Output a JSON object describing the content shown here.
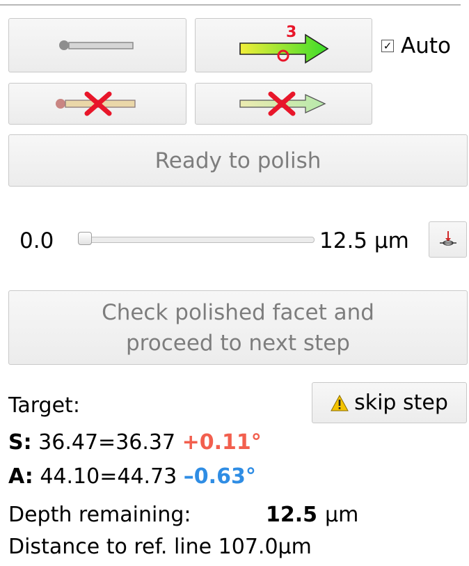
{
  "toolbar": {
    "auto_label": "Auto",
    "auto_checked": true,
    "arrow_badge": "3",
    "ready_label": "Ready to polish",
    "check_label_line1": "Check polished facet and",
    "check_label_line2": "proceed to next step",
    "skip_label": "skip step"
  },
  "slider": {
    "min_label": "0.0",
    "max_label": "12.5 µm",
    "value_fraction": 0.0
  },
  "target": {
    "label": "Target:",
    "s": {
      "letter": "S",
      "value": "36.47",
      "ref": "36.37",
      "sign": "+",
      "delta": "0.11°"
    },
    "a": {
      "letter": "A",
      "value": "44.10",
      "ref": "44.73",
      "sign": "–",
      "delta": "0.63°"
    }
  },
  "depth": {
    "label": "Depth remaining:",
    "value": "12.5",
    "unit": "µm"
  },
  "distance": {
    "label": "Distance to ref. line",
    "value": "107.0",
    "unit": "µm"
  },
  "colors": {
    "positive_delta": "#f25f4e",
    "negative_delta": "#2f8de4",
    "arrow_green": "#3cdc2a",
    "arrow_yellow": "#f2ee3a",
    "cross_red": "#e8162a"
  },
  "icons": {
    "btn1": "line-to-point-icon",
    "btn2": "green-arrow-icon",
    "btn3": "remove-line-icon",
    "btn4": "remove-arrow-icon",
    "slider_btn": "depth-probe-icon",
    "skip": "warning-icon"
  }
}
